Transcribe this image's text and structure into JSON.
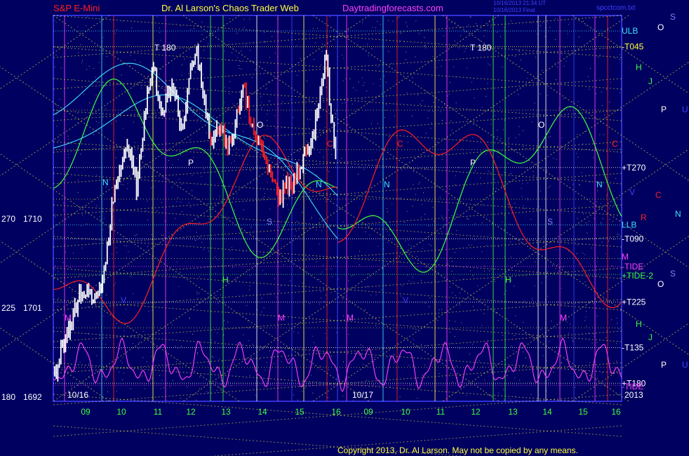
{
  "header": {
    "symbol": "S&P E-Mini",
    "title": "Dr. Al Larson's Chaos Trader Web",
    "site": "Daytradingforecasts.com",
    "stamp1": "10/16/2013 21:34 UT",
    "stamp2": "10/16/2013 Final",
    "file": "spcctcom.txt"
  },
  "footer": {
    "copyright": "Copyright 2013, Dr. Al Larson. May not be copied by any means."
  },
  "colors": {
    "background": "#000060",
    "frame": "#4040ff",
    "price_up": "#ffffff",
    "price_down": "#ff2020",
    "yellow_lines": "#ffff40",
    "tide": "#ff40ff",
    "tide2": "#40ff40",
    "cyan": "#40e0ff",
    "red": "#ff2020"
  },
  "chart_data": {
    "type": "line",
    "title": "S&P E-Mini",
    "y_ticks": [
      {
        "angle": "270",
        "price": "1710",
        "value": 1710
      },
      {
        "angle": "225",
        "price": "1701",
        "value": 1701
      },
      {
        "angle": "180",
        "price": "1692",
        "value": 1692
      }
    ],
    "ylim": [
      1692,
      1730
    ],
    "x_ticks": [
      "09",
      "10",
      "11",
      "12",
      "13",
      "14",
      "15",
      "16",
      "09",
      "10",
      "11",
      "12",
      "13",
      "14",
      "15",
      "16"
    ],
    "dates": [
      "10/16",
      "10/17"
    ],
    "year": "2013",
    "right_labels": [
      {
        "text": "ULB",
        "value": 1729.0,
        "color": "#40e0ff"
      },
      {
        "text": "-T045",
        "value": 1727.4,
        "color": "#ffff40"
      },
      {
        "text": "+T270",
        "value": 1715.2,
        "color": "#ffffff"
      },
      {
        "text": "LLB",
        "value": 1709.4,
        "color": "#40e0ff"
      },
      {
        "text": "-T090",
        "value": 1708.0,
        "color": "#ffffff"
      },
      {
        "text": "-TIDE",
        "value": 1705.2,
        "color": "#ff40ff"
      },
      {
        "text": "+TIDE-2",
        "value": 1704.4,
        "color": "#40ff40"
      },
      {
        "text": "+T225",
        "value": 1701.6,
        "color": "#ffffff"
      },
      {
        "text": "-T135",
        "value": 1697.0,
        "color": "#ffffff"
      },
      {
        "text": "+T180",
        "value": 1693.4,
        "color": "#ffffff"
      },
      {
        "text": "-TIDE",
        "value": 1693.2,
        "color": "#ff40ff"
      }
    ],
    "side_letters": [
      {
        "text": "O",
        "x": 937,
        "y": 43,
        "color": "#ffffff"
      },
      {
        "text": "S",
        "x": 955,
        "y": 28,
        "color": "#8080ff"
      },
      {
        "text": "H",
        "x": 906,
        "y": 100,
        "color": "#40ff40"
      },
      {
        "text": "J",
        "x": 924,
        "y": 120,
        "color": "#40ff40"
      },
      {
        "text": "P",
        "x": 942,
        "y": 160,
        "color": "#ffffff"
      },
      {
        "text": "U",
        "x": 972,
        "y": 160,
        "color": "#4040ff"
      },
      {
        "text": "V",
        "x": 897,
        "y": 278,
        "color": "#4040ff"
      },
      {
        "text": "C",
        "x": 934,
        "y": 282,
        "color": "#ff2020"
      },
      {
        "text": "R",
        "x": 913,
        "y": 314,
        "color": "#ff2020"
      },
      {
        "text": "N",
        "x": 962,
        "y": 309,
        "color": "#40e0ff"
      },
      {
        "text": "M",
        "x": 886,
        "y": 370,
        "color": "#ff40ff"
      },
      {
        "text": "S",
        "x": 955,
        "y": 394,
        "color": "#8080ff"
      },
      {
        "text": "O",
        "x": 937,
        "y": 409,
        "color": "#ffffff"
      },
      {
        "text": "H",
        "x": 906,
        "y": 466,
        "color": "#40ff40"
      },
      {
        "text": "J",
        "x": 924,
        "y": 485,
        "color": "#40ff40"
      },
      {
        "text": "P",
        "x": 942,
        "y": 524,
        "color": "#ffffff"
      },
      {
        "text": "U",
        "x": 972,
        "y": 524,
        "color": "#4040ff"
      }
    ],
    "in_chart_letters": [
      {
        "text": "T  180",
        "x": 220,
        "y": 72,
        "color": "#ffffff"
      },
      {
        "text": "T  180",
        "x": 670,
        "y": 72,
        "color": "#ffffff"
      },
      {
        "text": "O",
        "x": 366,
        "y": 182,
        "color": "#ffffff"
      },
      {
        "text": "O",
        "x": 767,
        "y": 182,
        "color": "#ffffff"
      },
      {
        "text": "P",
        "x": 268,
        "y": 236,
        "color": "#ffffff"
      },
      {
        "text": "P",
        "x": 670,
        "y": 236,
        "color": "#ffffff"
      },
      {
        "text": "N",
        "x": 146,
        "y": 264,
        "color": "#40e0ff"
      },
      {
        "text": "N",
        "x": 547,
        "y": 267,
        "color": "#40e0ff"
      },
      {
        "text": "N",
        "x": 450,
        "y": 267,
        "color": "#40e0ff"
      },
      {
        "text": "N",
        "x": 850,
        "y": 267,
        "color": "#40e0ff"
      },
      {
        "text": "S",
        "x": 380,
        "y": 320,
        "color": "#8080ff"
      },
      {
        "text": "S",
        "x": 780,
        "y": 320,
        "color": "#8080ff"
      },
      {
        "text": "C",
        "x": 466,
        "y": 209,
        "color": "#ff2020"
      },
      {
        "text": "C",
        "x": 566,
        "y": 209,
        "color": "#ff2020"
      },
      {
        "text": "C",
        "x": 872,
        "y": 209,
        "color": "#ff2020"
      },
      {
        "text": "H",
        "x": 317,
        "y": 403,
        "color": "#40ff40"
      },
      {
        "text": "H",
        "x": 720,
        "y": 403,
        "color": "#40ff40"
      },
      {
        "text": "M",
        "x": 92,
        "y": 457,
        "color": "#ff40ff"
      },
      {
        "text": "M",
        "x": 396,
        "y": 457,
        "color": "#ff40ff"
      },
      {
        "text": "M",
        "x": 494,
        "y": 457,
        "color": "#ff40ff"
      },
      {
        "text": "M",
        "x": 798,
        "y": 457,
        "color": "#ff40ff"
      },
      {
        "text": "V",
        "x": 172,
        "y": 432,
        "color": "#4040ff"
      },
      {
        "text": "V",
        "x": 574,
        "y": 432,
        "color": "#4040ff"
      }
    ],
    "vertical_lines": [
      {
        "x": 92,
        "color": "#ff40ff"
      },
      {
        "x": 145,
        "color": "#40e0ff"
      },
      {
        "x": 162,
        "color": "#ff2020"
      },
      {
        "x": 218,
        "color": "#ffff40"
      },
      {
        "x": 236,
        "color": "#ff40ff"
      },
      {
        "x": 300,
        "color": "#40ff40"
      },
      {
        "x": 318,
        "color": "#40ff40"
      },
      {
        "x": 366,
        "color": "#ffffff"
      },
      {
        "x": 396,
        "color": "#ff40ff"
      },
      {
        "x": 416,
        "color": "#4040ff"
      },
      {
        "x": 433,
        "color": "#ffff40"
      },
      {
        "x": 466,
        "color": "#ff2020"
      },
      {
        "x": 494,
        "color": "#ff40ff"
      },
      {
        "x": 546,
        "color": "#40e0ff"
      },
      {
        "x": 566,
        "color": "#ff2020"
      },
      {
        "x": 620,
        "color": "#ffff40"
      },
      {
        "x": 637,
        "color": "#ff40ff"
      },
      {
        "x": 703,
        "color": "#40ff40"
      },
      {
        "x": 720,
        "color": "#40ff40"
      },
      {
        "x": 767,
        "color": "#ffffff"
      },
      {
        "x": 778,
        "color": "#ffffff"
      },
      {
        "x": 798,
        "color": "#ff40ff"
      },
      {
        "x": 818,
        "color": "#4040ff"
      },
      {
        "x": 848,
        "color": "#ff40ff"
      },
      {
        "x": 866,
        "color": "#ff2020"
      }
    ],
    "grid": true
  }
}
